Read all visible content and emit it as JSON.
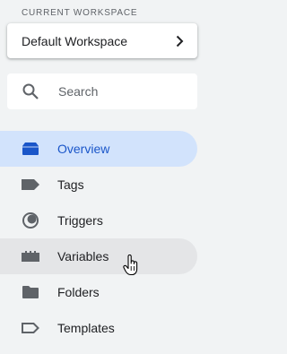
{
  "workspace": {
    "section_label": "CURRENT WORKSPACE",
    "name": "Default Workspace",
    "chevron_icon": "chevron-right-icon"
  },
  "search": {
    "placeholder": "Search",
    "value": "",
    "icon": "search-icon"
  },
  "nav": {
    "active_color": "#1a56c9",
    "active_background": "#d2e3fc",
    "items": [
      {
        "label": "Overview",
        "icon": "overview-icon",
        "state": "active"
      },
      {
        "label": "Tags",
        "icon": "tag-icon",
        "state": ""
      },
      {
        "label": "Triggers",
        "icon": "trigger-icon",
        "state": ""
      },
      {
        "label": "Variables",
        "icon": "variables-icon",
        "state": "hover"
      },
      {
        "label": "Folders",
        "icon": "folder-icon",
        "state": ""
      },
      {
        "label": "Templates",
        "icon": "template-icon",
        "state": ""
      }
    ]
  }
}
